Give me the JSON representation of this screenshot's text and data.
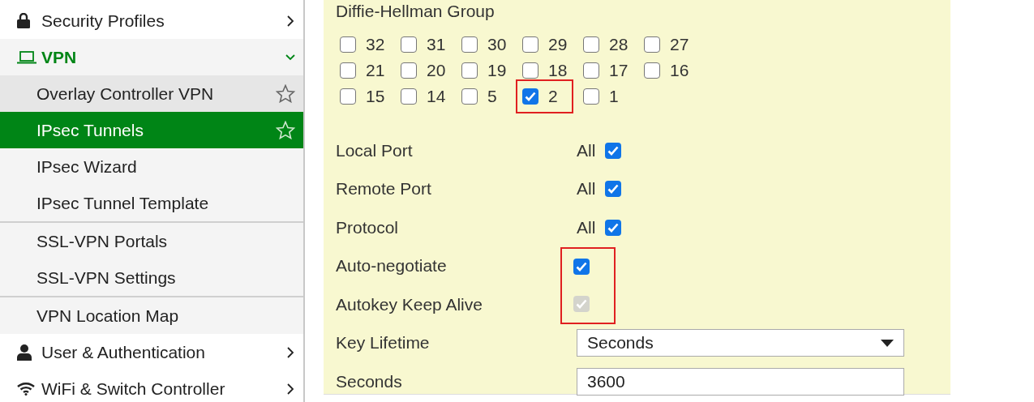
{
  "sidebar": {
    "items": [
      {
        "label": "Security Profiles",
        "kind": "section",
        "expanded": false
      },
      {
        "label": "VPN",
        "kind": "section",
        "expanded": true,
        "children": [
          {
            "label": "Overlay Controller VPN",
            "selected": false,
            "hovered": true,
            "favorite": true,
            "group_end": false
          },
          {
            "label": "IPsec Tunnels",
            "selected": true,
            "hovered": false,
            "favorite": true,
            "group_end": false
          },
          {
            "label": "IPsec Wizard",
            "selected": false,
            "hovered": false,
            "favorite": false,
            "group_end": false
          },
          {
            "label": "IPsec Tunnel Template",
            "selected": false,
            "hovered": false,
            "favorite": false,
            "group_end": true
          },
          {
            "label": "SSL-VPN Portals",
            "selected": false,
            "hovered": false,
            "favorite": false,
            "group_end": false
          },
          {
            "label": "SSL-VPN Settings",
            "selected": false,
            "hovered": false,
            "favorite": false,
            "group_end": true
          },
          {
            "label": "VPN Location Map",
            "selected": false,
            "hovered": false,
            "favorite": false,
            "group_end": false
          }
        ]
      },
      {
        "label": "User & Authentication",
        "kind": "section",
        "expanded": false
      },
      {
        "label": "WiFi & Switch Controller",
        "kind": "section",
        "expanded": false
      }
    ]
  },
  "form": {
    "dh_group": {
      "title": "Diffie-Hellman Group",
      "options": [
        {
          "label": "32",
          "checked": false,
          "highlighted": false
        },
        {
          "label": "31",
          "checked": false,
          "highlighted": false
        },
        {
          "label": "30",
          "checked": false,
          "highlighted": false
        },
        {
          "label": "29",
          "checked": false,
          "highlighted": false
        },
        {
          "label": "28",
          "checked": false,
          "highlighted": false
        },
        {
          "label": "27",
          "checked": false,
          "highlighted": false
        },
        {
          "label": "21",
          "checked": false,
          "highlighted": false
        },
        {
          "label": "20",
          "checked": false,
          "highlighted": false
        },
        {
          "label": "19",
          "checked": false,
          "highlighted": false
        },
        {
          "label": "18",
          "checked": false,
          "highlighted": false
        },
        {
          "label": "17",
          "checked": false,
          "highlighted": false
        },
        {
          "label": "16",
          "checked": false,
          "highlighted": false
        },
        {
          "label": "15",
          "checked": false,
          "highlighted": false
        },
        {
          "label": "14",
          "checked": false,
          "highlighted": false
        },
        {
          "label": "5",
          "checked": false,
          "highlighted": false
        },
        {
          "label": "2",
          "checked": true,
          "highlighted": true
        },
        {
          "label": "1",
          "checked": false,
          "highlighted": false
        }
      ]
    },
    "rows": [
      {
        "kind": "all-check",
        "label": "Local Port",
        "text": "All",
        "checked": true
      },
      {
        "kind": "all-check",
        "label": "Remote Port",
        "text": "All",
        "checked": true
      },
      {
        "kind": "all-check",
        "label": "Protocol",
        "text": "All",
        "checked": true
      },
      {
        "kind": "check",
        "label": "Auto-negotiate",
        "checked": true,
        "disabled": false,
        "highlighted": true
      },
      {
        "kind": "check",
        "label": "Autokey Keep Alive",
        "checked": true,
        "disabled": true,
        "highlighted": true
      },
      {
        "kind": "select",
        "label": "Key Lifetime",
        "value": "Seconds"
      },
      {
        "kind": "text",
        "label": "Seconds",
        "value": "3600"
      }
    ]
  }
}
